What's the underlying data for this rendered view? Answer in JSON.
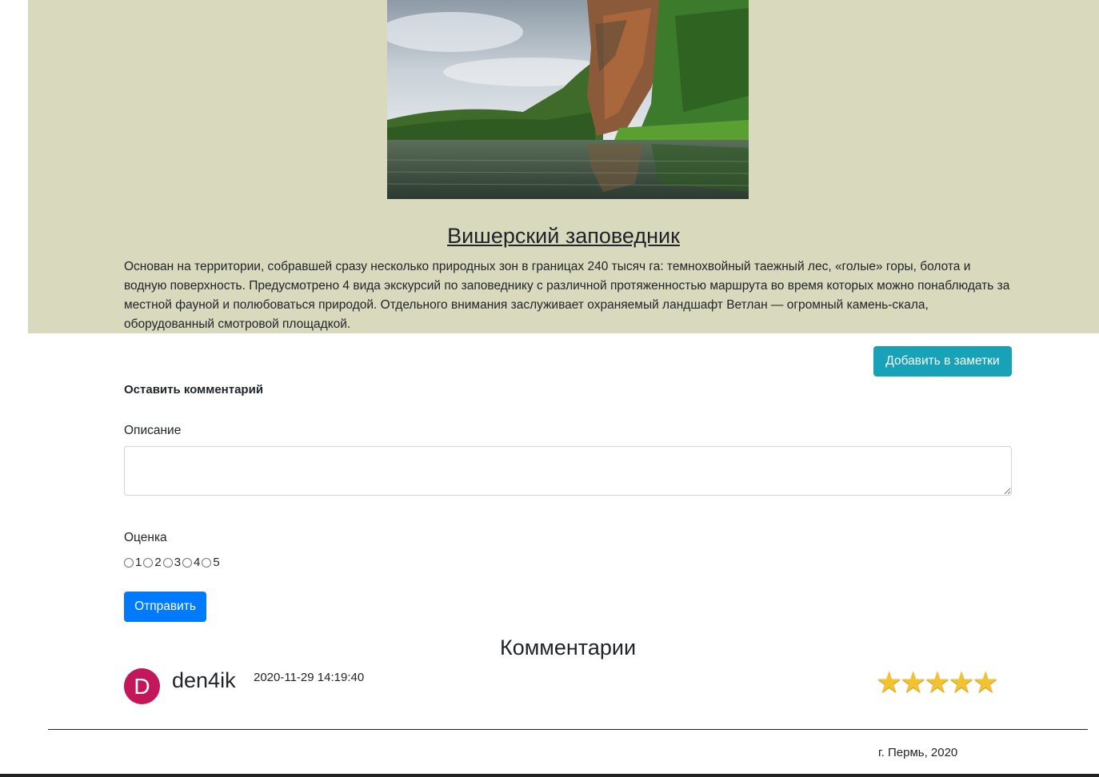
{
  "place": {
    "title": "Вишерский заповедник",
    "description": "Основан на территории, собравшей сразу несколько природных зон в границах 240 тысяч га: темнохвойный таежный лес, «голые» горы, болота и водную поверхность. Предусмотрено 4 вида экскурсий по заповеднику с различной протяженностью маршрута во время которых можно понаблюдать за местной фауной и полюбоваться природой. Отдельного внимания заслуживает охраняемый ландшафт Ветлан — огромный камень-скала, оборудованный смотровой площадкой."
  },
  "actions": {
    "add_notes_label": "Добавить в заметки"
  },
  "form": {
    "heading": "Оставить комментарий",
    "description_label": "Описание",
    "description_value": "",
    "rating_label": "Оценка",
    "rating_options": [
      "1",
      "2",
      "3",
      "4",
      "5"
    ],
    "submit_label": "Отправить"
  },
  "comments": {
    "heading": "Комментарии",
    "items": [
      {
        "avatar_letter": "D",
        "avatar_color": "#c2185b",
        "user": "den4ik",
        "timestamp": "2020-11-29 14:19:40",
        "rating": 5,
        "stars": "★★★★★"
      }
    ]
  },
  "footer": {
    "text": "г. Пермь, 2020"
  },
  "colors": {
    "hero_bg": "#d9d9bd",
    "notes_button": "#17a2b8",
    "submit_button": "#007bff",
    "star": "#f2c230"
  }
}
